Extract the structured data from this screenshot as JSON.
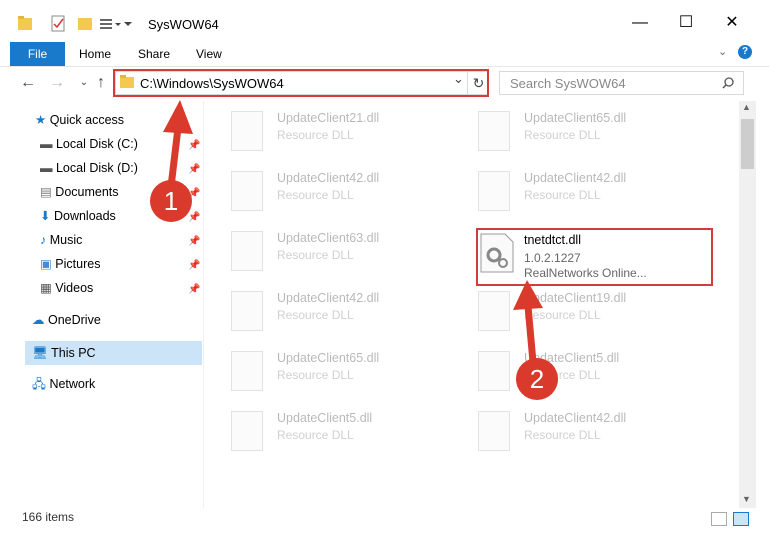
{
  "window": {
    "title": "SysWOW64",
    "minimize": "—",
    "maximize": "☐",
    "close": "✕"
  },
  "ribbon": {
    "file": "File",
    "home": "Home",
    "share": "Share",
    "view": "View"
  },
  "address": {
    "path": "C:\\Windows\\SysWOW64",
    "refresh": "↻",
    "dropdown": "⌄"
  },
  "search": {
    "placeholder": "Search SysWOW64"
  },
  "sidebar": {
    "quick_access": "Quick access",
    "items": [
      "Local Disk (C:)",
      "Local Disk (D:)",
      "Documents",
      "Downloads",
      "Music",
      "Pictures",
      "Videos"
    ],
    "onedrive": "OneDrive",
    "this_pc": "This PC",
    "network": "Network"
  },
  "files": [
    {
      "name": "UpdateClient21.dll",
      "type": "Resource DLL"
    },
    {
      "name": "UpdateClient65.dll",
      "type": "Resource DLL"
    },
    {
      "name": "UpdateClient42.dll",
      "type": "Resource DLL"
    },
    {
      "name": "UpdateClient42.dll",
      "type": "Resource DLL"
    },
    {
      "name": "UpdateClient63.dll",
      "type": "Resource DLL"
    },
    {
      "name": "UpdateClient42.dll",
      "type": "Resource DLL"
    },
    {
      "name": "UpdateClient19.dll",
      "type": "Resource DLL"
    },
    {
      "name": "UpdateClient65.dll",
      "type": "Resource DLL"
    },
    {
      "name": "UpdateClient5.dll",
      "type": "Resource DLL"
    },
    {
      "name": "UpdateClient5.dll",
      "type": "Resource DLL"
    },
    {
      "name": "UpdateClient42.dll",
      "type": "Resource DLL"
    }
  ],
  "target_file": {
    "name": "tnetdtct.dll",
    "version": "1.0.2.1227",
    "company": "RealNetworks Online..."
  },
  "status": {
    "items": "166 items"
  },
  "annotations": {
    "step1": "1",
    "step2": "2"
  },
  "colors": {
    "accent": "#1979ca",
    "highlight": "#d43b3b",
    "marker": "#d93a2b"
  }
}
